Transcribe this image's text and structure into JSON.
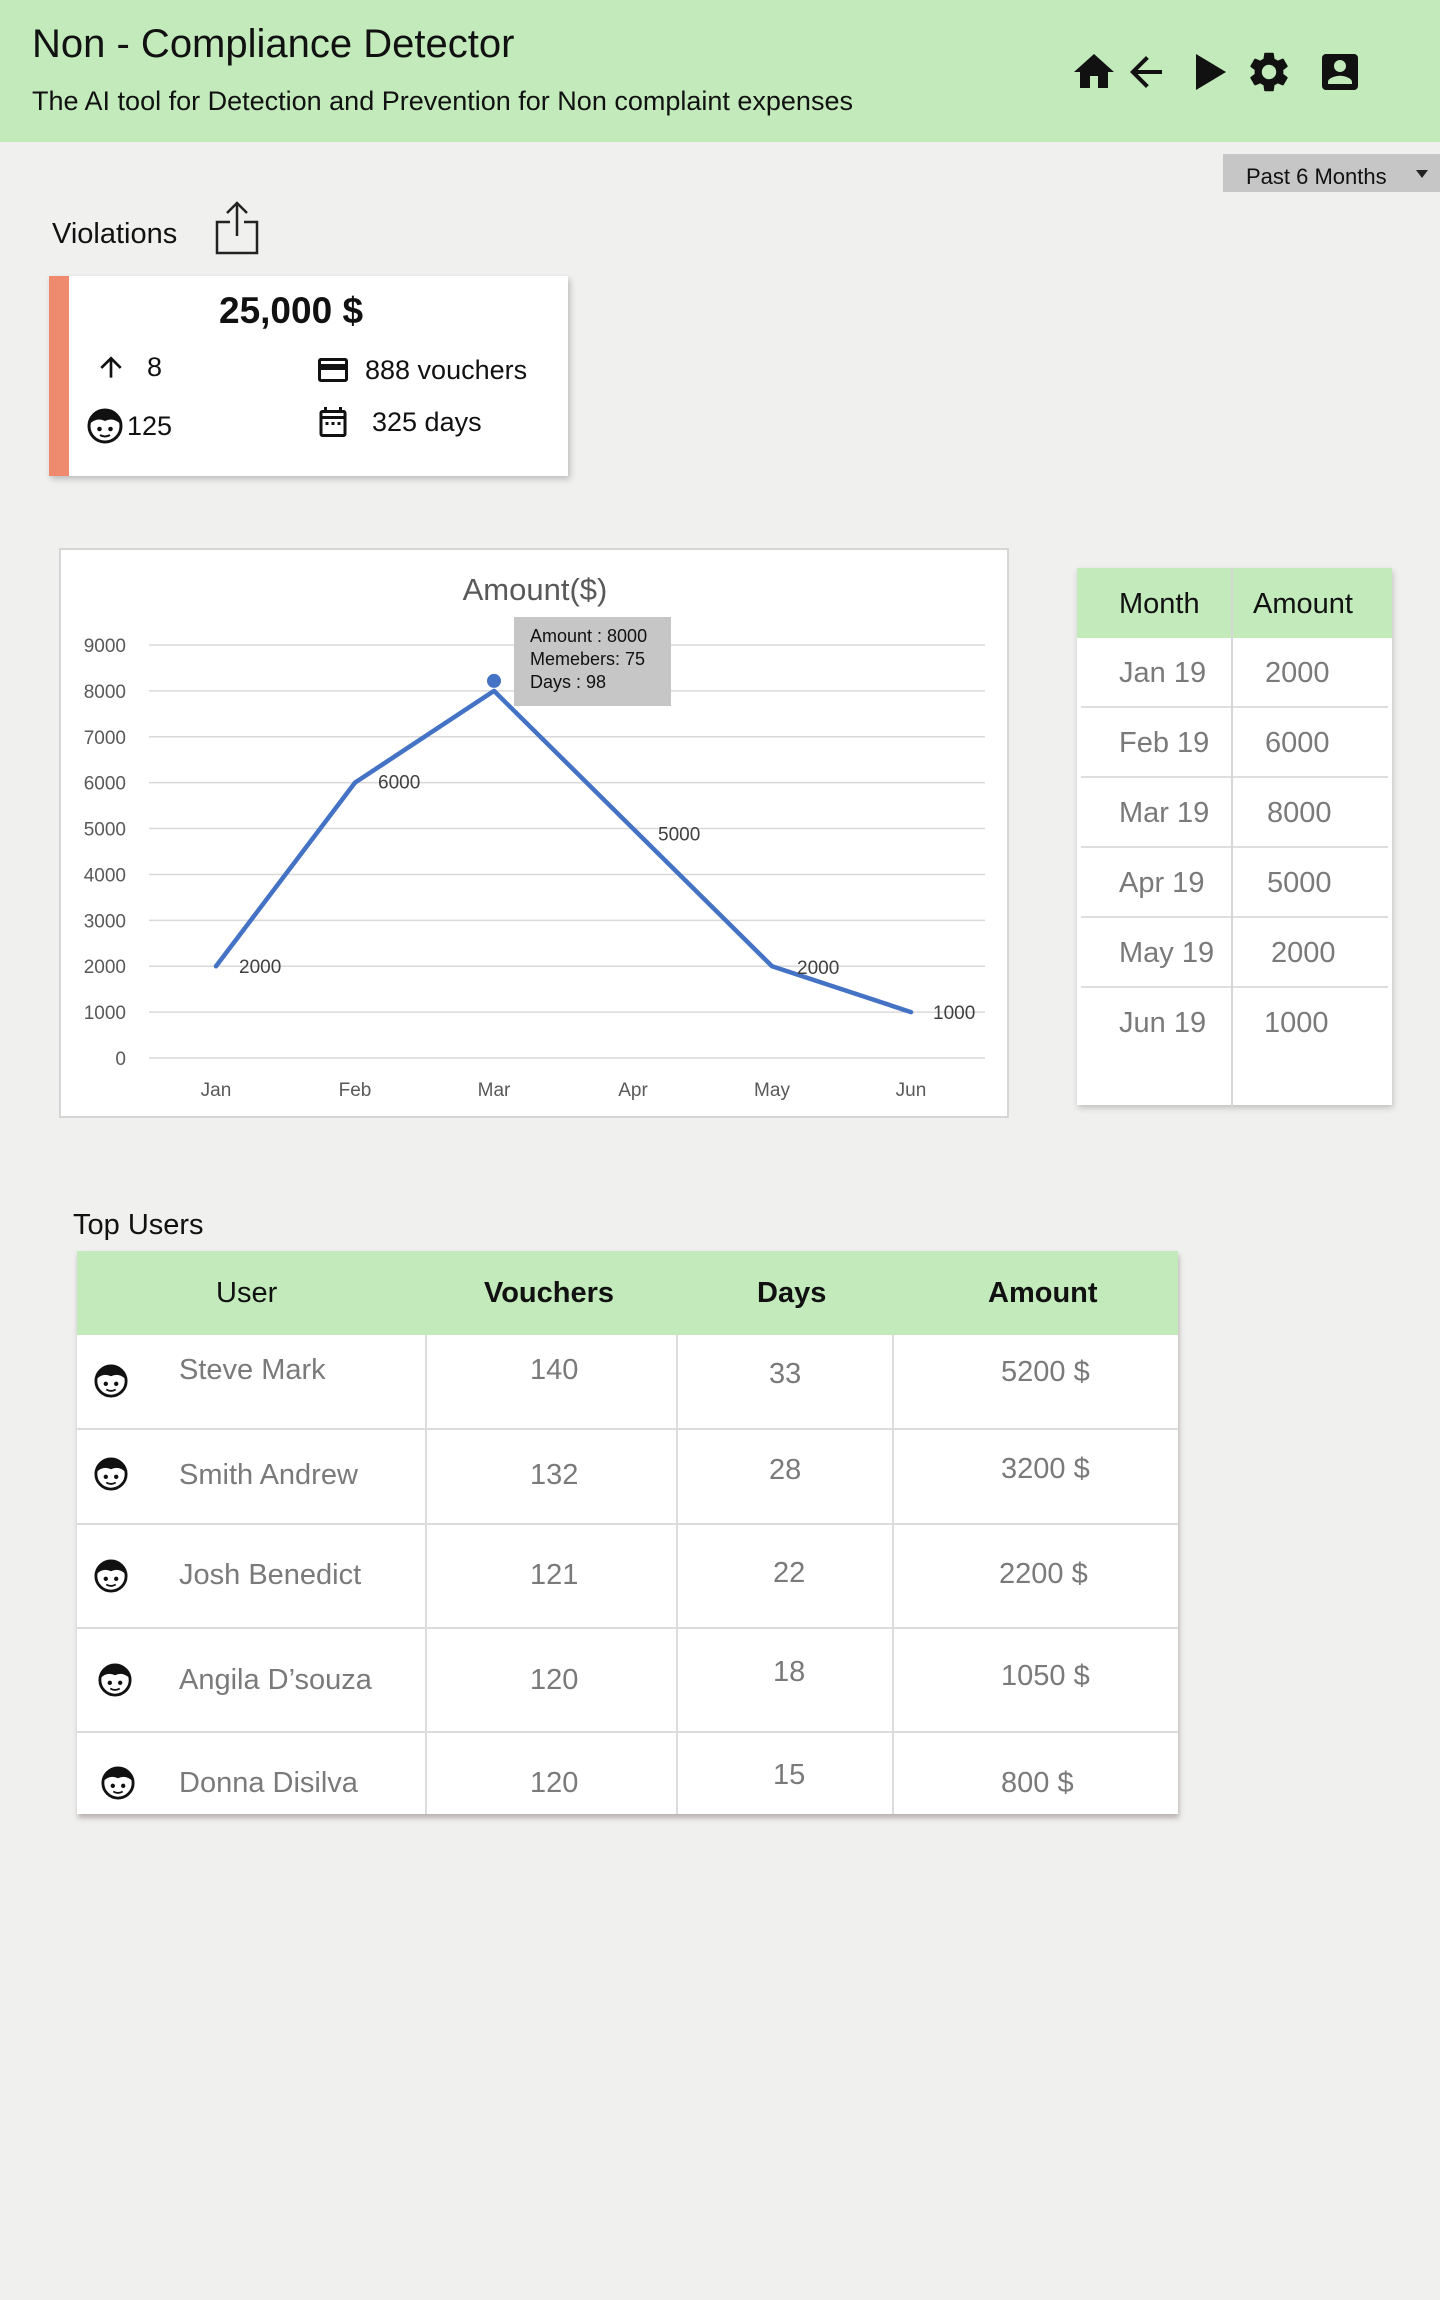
{
  "app": {
    "title": "Non - Compliance Detector",
    "subtitle": "The AI tool for Detection and Prevention for Non complaint expenses"
  },
  "header_icons": [
    "home-icon",
    "arrow-left-icon",
    "play-icon",
    "gear-icon",
    "account-box-icon"
  ],
  "filter": {
    "period": "Past 6 Months"
  },
  "violations": {
    "title": "Violations",
    "amount": "25,000 $",
    "increase": "8",
    "users": "125",
    "vouchers": "888 vouchers",
    "days": "325 days"
  },
  "colors": {
    "header_bg": "#c2eabb",
    "accent": "#ee8a6d",
    "line": "#4472c4"
  },
  "chart_data": {
    "type": "line",
    "title": "Amount($)",
    "categories": [
      "Jan",
      "Feb",
      "Mar",
      "Apr",
      "May",
      "Jun"
    ],
    "values": [
      2000,
      6000,
      8000,
      5000,
      2000,
      1000
    ],
    "ylim": [
      0,
      9000
    ],
    "yticks": [
      0,
      1000,
      2000,
      3000,
      4000,
      5000,
      6000,
      7000,
      8000,
      9000
    ],
    "grid": true,
    "tooltip": {
      "index": 2,
      "lines": [
        "Amount : 8000",
        "Memebers: 75",
        "Days : 98"
      ]
    }
  },
  "month_table": {
    "headers": [
      "Month",
      "Amount"
    ],
    "rows": [
      {
        "month": "Jan 19",
        "amount": "2000"
      },
      {
        "month": "Feb 19",
        "amount": "6000"
      },
      {
        "month": "Mar 19",
        "amount": "8000"
      },
      {
        "month": "Apr 19",
        "amount": "5000"
      },
      {
        "month": "May 19",
        "amount": "2000"
      },
      {
        "month": "Jun 19",
        "amount": "1000"
      }
    ]
  },
  "top_users": {
    "title": "Top Users",
    "headers": [
      "User",
      "Vouchers",
      "Days",
      "Amount"
    ],
    "rows": [
      {
        "user": "Steve Mark",
        "vouchers": "140",
        "days": "33",
        "amount": "5200 $"
      },
      {
        "user": "Smith Andrew",
        "vouchers": "132",
        "days": "28",
        "amount": "3200 $"
      },
      {
        "user": "Josh Benedict",
        "vouchers": "121",
        "days": "22",
        "amount": "2200 $"
      },
      {
        "user": "Angila D’souza",
        "vouchers": "120",
        "days": "18",
        "amount": "1050 $"
      },
      {
        "user": "Donna Disilva",
        "vouchers": "120",
        "days": "15",
        "amount": "800  $"
      }
    ]
  }
}
